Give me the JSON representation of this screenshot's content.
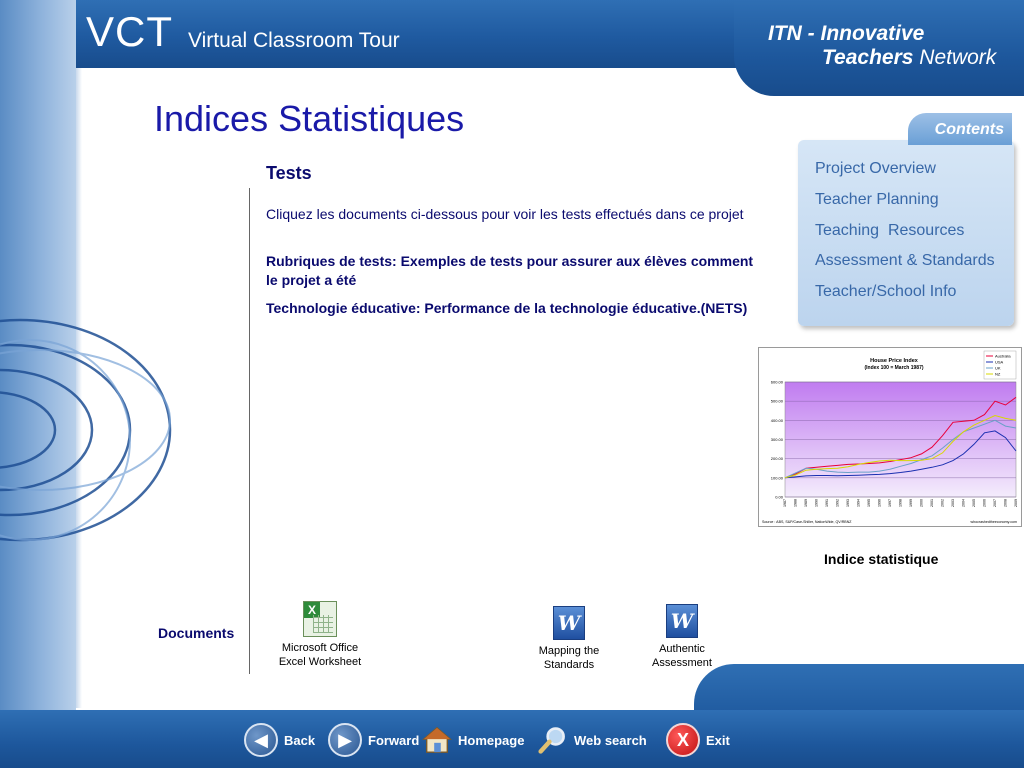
{
  "header": {
    "logo": "VCT",
    "subtitle": "Virtual Classroom Tour",
    "network_line1": "ITN - Innovative",
    "network_line2_bold": "Teachers",
    "network_line2_rest": " Network"
  },
  "page": {
    "title": "Indices Statistiques",
    "section_title": "Tests",
    "intro": "Cliquez les documents ci-dessous pour voir les tests effectués dans ce projet",
    "link1": "Rubriques de tests: Exemples de tests pour assurer aux élèves comment le  projet a été",
    "link2": "Technologie éducative: Performance de la technologie éducative.(NETS)",
    "documents_label": "Documents",
    "chart_caption": "Indice statistique"
  },
  "documents": [
    {
      "line1": "Microsoft Office",
      "line2": "Excel Worksheet",
      "icon": "excel-icon"
    },
    {
      "line1": "Mapping the",
      "line2": "Standards",
      "icon": "word-icon"
    },
    {
      "line1": "Authentic",
      "line2": "Assessment",
      "icon": "word-icon"
    }
  ],
  "contents": {
    "tab": "Contents",
    "items": [
      "Project Overview",
      "Teacher Planning",
      "Teaching  Resources",
      "Assessment & Standards",
      "Teacher/School Info"
    ]
  },
  "nav": {
    "back": "Back",
    "forward": "Forward",
    "homepage": "Homepage",
    "search": "Web search",
    "exit": "Exit"
  },
  "colors": {
    "brand_blue": "#1f5aa0",
    "title_blue": "#1a1aa8",
    "text_navy": "#0a0a6e",
    "menu_blue": "#3868a8"
  },
  "chart_data": {
    "type": "line",
    "title": "House Price Index",
    "subtitle": "(Index 100 = March 1987)",
    "source": "Source : ABS, S&P/Case-Shiller, NationWide, QV/RBNZ",
    "credit": "whocrashedtheeconomy.com",
    "x": [
      "1987",
      "1988",
      "1989",
      "1990",
      "1991",
      "1992",
      "1993",
      "1994",
      "1995",
      "1996",
      "1997",
      "1998",
      "1999",
      "2000",
      "2001",
      "2002",
      "2003",
      "2004",
      "2005",
      "2006",
      "2007",
      "2008",
      "2009"
    ],
    "ylim": [
      0,
      600
    ],
    "yticks": [
      "0.00",
      "100.00",
      "200.00",
      "300.00",
      "400.00",
      "500.00",
      "600.00"
    ],
    "legend_position": "top-right",
    "series": [
      {
        "name": "Australia",
        "color": "#e8003a",
        "values": [
          100,
          120,
          150,
          155,
          160,
          165,
          170,
          172,
          175,
          178,
          185,
          195,
          205,
          225,
          260,
          320,
          390,
          395,
          400,
          430,
          500,
          480,
          520
        ]
      },
      {
        "name": "USA",
        "color": "#1a2fb0",
        "values": [
          100,
          105,
          110,
          112,
          112,
          111,
          112,
          114,
          116,
          118,
          122,
          128,
          135,
          145,
          155,
          168,
          190,
          225,
          275,
          335,
          345,
          310,
          240
        ]
      },
      {
        "name": "UK",
        "color": "#6aa0c8",
        "values": [
          100,
          125,
          150,
          145,
          135,
          130,
          128,
          130,
          130,
          135,
          145,
          160,
          175,
          195,
          215,
          255,
          300,
          340,
          360,
          380,
          400,
          370,
          360
        ]
      },
      {
        "name": "NZ",
        "color": "#d8d800",
        "values": [
          100,
          115,
          140,
          145,
          148,
          150,
          158,
          170,
          180,
          188,
          192,
          190,
          190,
          192,
          200,
          230,
          290,
          340,
          375,
          400,
          425,
          410,
          400
        ]
      }
    ]
  }
}
